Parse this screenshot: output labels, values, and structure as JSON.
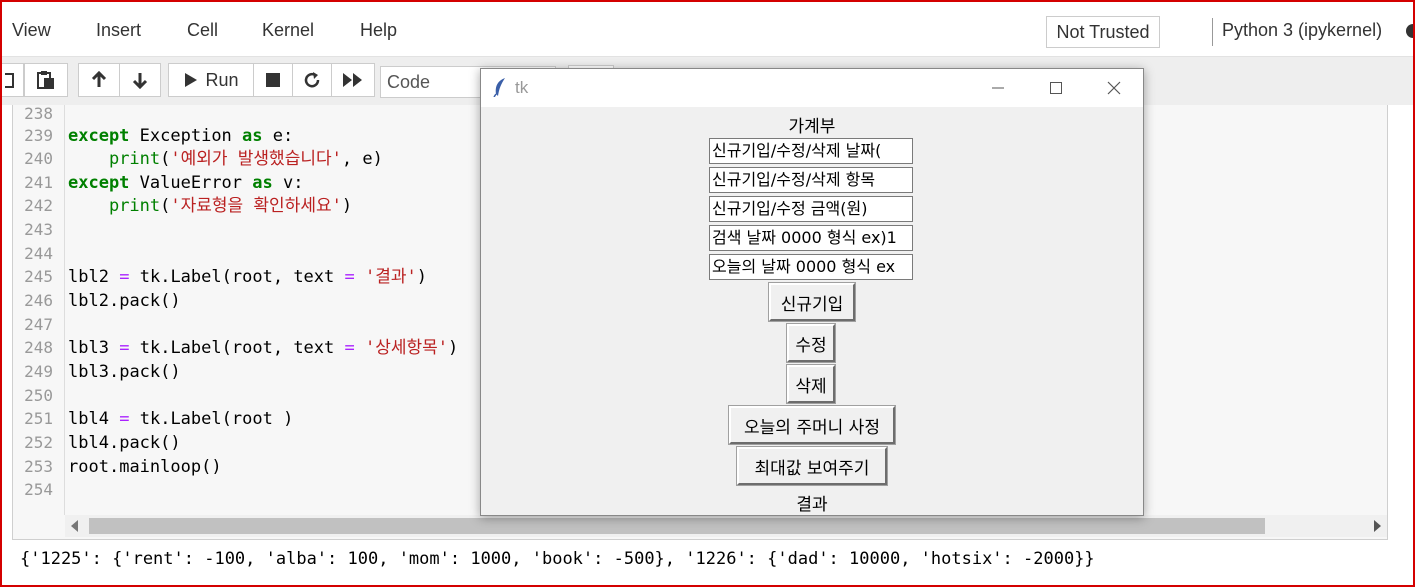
{
  "menubar": {
    "items": [
      "View",
      "Insert",
      "Cell",
      "Kernel",
      "Help"
    ],
    "trust_status": "Not Trusted",
    "kernel_name": "Python 3 (ipykernel)"
  },
  "toolbar": {
    "run_label": "Run",
    "cell_type": "Code"
  },
  "code": {
    "lines": [
      {
        "num": "238",
        "text": ""
      },
      {
        "num": "239",
        "text": "except Exception as e:"
      },
      {
        "num": "240",
        "text": "    print('예외가 발생했습니다', e)"
      },
      {
        "num": "241",
        "text": "except ValueError as v:"
      },
      {
        "num": "242",
        "text": "    print('자료형을 확인하세요')"
      },
      {
        "num": "243",
        "text": ""
      },
      {
        "num": "244",
        "text": ""
      },
      {
        "num": "245",
        "text": "lbl2 = tk.Label(root, text = '결과')"
      },
      {
        "num": "246",
        "text": "lbl2.pack()"
      },
      {
        "num": "247",
        "text": ""
      },
      {
        "num": "248",
        "text": "lbl3 = tk.Label(root, text = '상세항목')"
      },
      {
        "num": "249",
        "text": "lbl3.pack()"
      },
      {
        "num": "250",
        "text": ""
      },
      {
        "num": "251",
        "text": "lbl4 = tk.Label(root )"
      },
      {
        "num": "252",
        "text": "lbl4.pack()"
      },
      {
        "num": "253",
        "text": "root.mainloop()"
      },
      {
        "num": "254",
        "text": ""
      }
    ]
  },
  "output": {
    "text": "{'1225': {'rent': -100, 'alba': 100, 'mom': 1000, 'book': -500}, '1226': {'dad': 10000, 'hotsix': -2000}}"
  },
  "tk_window": {
    "title": "tk",
    "heading": "가계부",
    "entries": [
      "신규기입/수정/삭제 날짜(",
      "신규기입/수정/삭제 항목",
      "신규기입/수정 금액(원)",
      "검색 날짜 0000 형식 ex)1",
      "오늘의 날짜 0000 형식 ex"
    ],
    "buttons": {
      "new_entry": "신규기입",
      "edit": "수정",
      "delete": "삭제",
      "today_wallet": "오늘의 주머니 사정",
      "show_max": "최대값 보여주기"
    },
    "result_label": "결과"
  }
}
